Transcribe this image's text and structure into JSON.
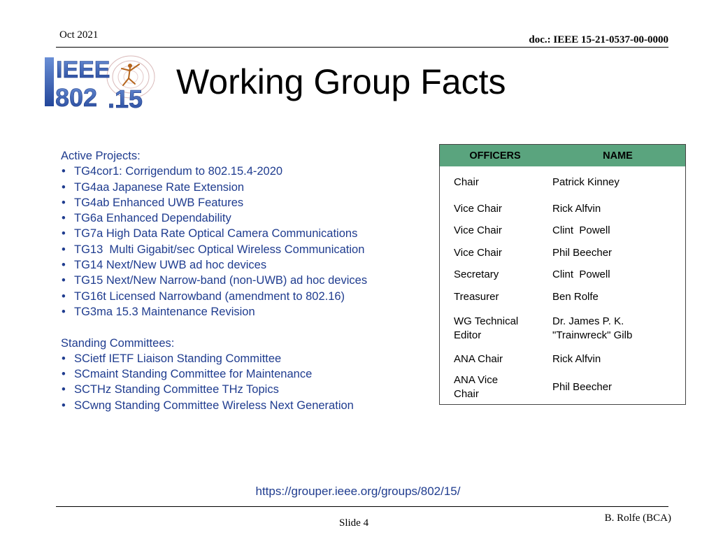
{
  "header": {
    "date": "Oct 2021",
    "doc_id": "doc.: IEEE 15-21-0537-00-0000"
  },
  "logo": {
    "line1": "IEEE",
    "line2a": "802",
    "line2b": ".15"
  },
  "title": "Working Group Facts",
  "active_projects": {
    "heading": "Active Projects:",
    "items": [
      "TG4cor1: Corrigendum to 802.15.4-2020",
      "TG4aa Japanese Rate Extension",
      "TG4ab Enhanced UWB Features",
      "TG6a Enhanced Dependability",
      "TG7a High Data Rate Optical Camera Communications",
      "TG13  Multi Gigabit/sec Optical Wireless Communication",
      "TG14 Next/New UWB ad hoc devices",
      "TG15 Next/New Narrow-band (non-UWB) ad hoc devices",
      "TG16t Licensed Narrowband (amendment to 802.16)",
      "TG3ma 15.3 Maintenance Revision"
    ]
  },
  "standing_committees": {
    "heading": "Standing Committees:",
    "items": [
      "SCietf IETF Liaison Standing Committee",
      "SCmaint Standing Committee for Maintenance",
      "SCTHz Standing Committee THz Topics",
      "SCwng Standing Committee Wireless Next Generation"
    ]
  },
  "officers_table": {
    "columns": [
      "OFFICERS",
      "NAME"
    ],
    "rows": [
      {
        "role": "Chair",
        "name": "Patrick Kinney"
      },
      {
        "role": "Vice Chair",
        "name": "Rick Alfvin"
      },
      {
        "role": "Vice Chair",
        "name": "Clint  Powell"
      },
      {
        "role": "Vice Chair",
        "name": "Phil Beecher"
      },
      {
        "role": "Secretary",
        "name": "Clint  Powell"
      },
      {
        "role": "Treasurer",
        "name": "Ben Rolfe"
      },
      {
        "role": "WG Technical Editor",
        "name": "Dr. James P. K. \"Trainwreck\" Gilb"
      },
      {
        "role": "ANA Chair",
        "name": "Rick Alfvin"
      },
      {
        "role": "ANA Vice Chair",
        "name": "Phil Beecher"
      }
    ]
  },
  "url": "https://grouper.ieee.org/groups/802/15/",
  "footer": {
    "slide": "Slide 4",
    "author": "B. Rolfe (BCA)"
  },
  "colors": {
    "body_text": "#1f3c8f",
    "table_header": "#5aa47e",
    "logo_blue": "#2f56a8"
  }
}
